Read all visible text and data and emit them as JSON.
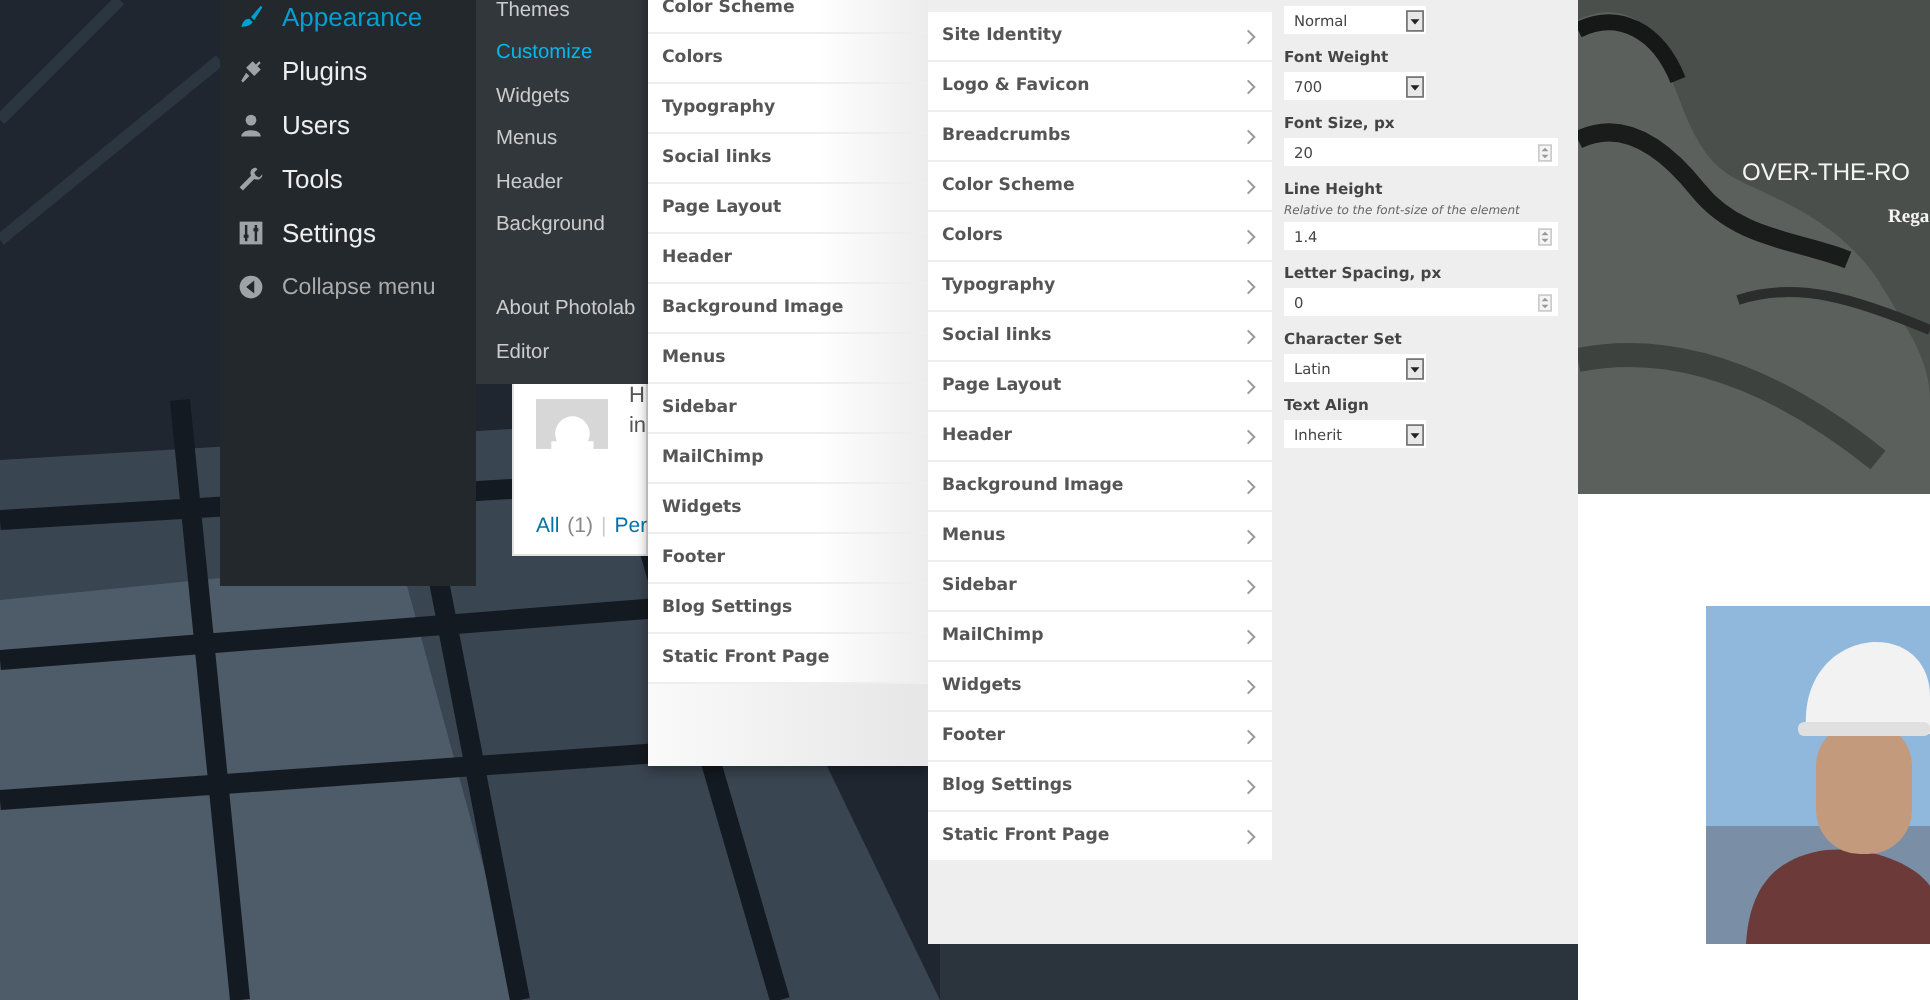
{
  "admin_menu": {
    "items": [
      {
        "label": "Appearance",
        "selected": true
      },
      {
        "label": "Plugins",
        "selected": false
      },
      {
        "label": "Users",
        "selected": false
      },
      {
        "label": "Tools",
        "selected": false
      },
      {
        "label": "Settings",
        "selected": false
      }
    ],
    "collapse": "Collapse menu"
  },
  "submenu": {
    "items": [
      {
        "label": "Themes",
        "selected": false
      },
      {
        "label": "Customize",
        "selected": true
      },
      {
        "label": "Widgets",
        "selected": false
      },
      {
        "label": "Menus",
        "selected": false
      },
      {
        "label": "Header",
        "selected": false
      },
      {
        "label": "Background",
        "selected": false
      }
    ],
    "extra_items": [
      {
        "label": "About Photolab",
        "selected": false
      },
      {
        "label": "Editor",
        "selected": false
      }
    ]
  },
  "comment_card": {
    "lines": [
      "H",
      "in"
    ],
    "filter_all": "All",
    "filter_count": "(1)",
    "separator": "|",
    "filter_next": "Per"
  },
  "customizer_back": {
    "sections": [
      "Color Scheme",
      "Colors",
      "Typography",
      "Social links",
      "Page Layout",
      "Header",
      "Background Image",
      "Menus",
      "Sidebar",
      "MailChimp",
      "Widgets",
      "Footer",
      "Blog Settings",
      "Static Front Page"
    ]
  },
  "customizer_front": {
    "sections": [
      "Site Identity",
      "Logo & Favicon",
      "Breadcrumbs",
      "Color Scheme",
      "Colors",
      "Typography",
      "Social links",
      "Page Layout",
      "Header",
      "Background Image",
      "Menus",
      "Sidebar",
      "MailChimp",
      "Widgets",
      "Footer",
      "Blog Settings",
      "Static Front Page"
    ],
    "controls": [
      {
        "kind": "select",
        "value": "Normal"
      },
      {
        "kind": "select",
        "label": "Font Weight",
        "value": "700"
      },
      {
        "kind": "number",
        "label": "Font Size, px",
        "value": "20"
      },
      {
        "kind": "number",
        "label": "Line Height",
        "hint": "Relative to the font-size of the element",
        "value": "1.4"
      },
      {
        "kind": "number",
        "label": "Letter Spacing, px",
        "value": "0"
      },
      {
        "kind": "select",
        "label": "Character Set",
        "value": "Latin"
      },
      {
        "kind": "select",
        "label": "Text Align",
        "value": "Inherit"
      }
    ]
  },
  "hero": {
    "title": "OVER-THE-RO",
    "subtitle": "Rega"
  }
}
